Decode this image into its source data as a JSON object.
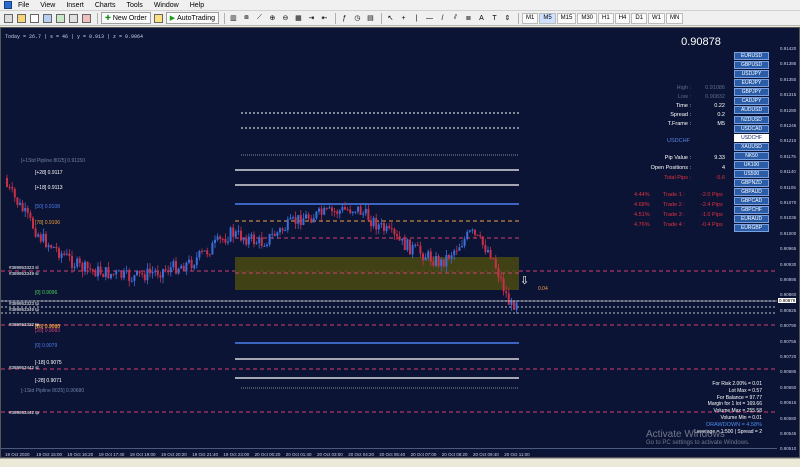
{
  "menu": [
    "File",
    "View",
    "Insert",
    "Charts",
    "Tools",
    "Window",
    "Help"
  ],
  "toolbar": {
    "new_order": "New Order",
    "autotrading": "AutoTrading",
    "timeframes": [
      "M1",
      "M5",
      "M15",
      "M30",
      "H1",
      "H4",
      "D1",
      "W1",
      "MN"
    ],
    "active_tf": "M5"
  },
  "infoline": "Today = 26.7   |   s = 46   |   y = 0.913   |   z = 0.9064",
  "panel": {
    "price": "0.90878",
    "rows": [
      {
        "k": "High :",
        "v": "0.91086",
        "dim": true
      },
      {
        "k": "Low :",
        "v": "0.90832",
        "dim": true
      },
      {
        "k": "Time :",
        "v": "0.22",
        "dim": false
      },
      {
        "k": "Spread :",
        "v": "0.2",
        "dim": false
      },
      {
        "k": "T.Frame :",
        "v": "M5",
        "dim": false
      }
    ],
    "symbol": "USDCHF",
    "pip_rows": [
      {
        "k": "Pip Value :",
        "v": "9.33",
        "color": "#ffffff"
      },
      {
        "k": "Open Positions :",
        "v": "4",
        "color": "#ffffff"
      },
      {
        "k": "Total Pips :",
        "v": "-5.6",
        "color": "#e03040"
      }
    ],
    "trades": [
      {
        "pct": "4.44%",
        "name": "Trade 1 :",
        "pips": "-2.0 Pips"
      },
      {
        "pct": "4.68%",
        "name": "Trade 2 :",
        "pips": "-2.4 Pips"
      },
      {
        "pct": "4.51%",
        "name": "Trade 3 :",
        "pips": "-1.0 Pips"
      },
      {
        "pct": "4.76%",
        "name": "Trade 4 :",
        "pips": "-0.4 Pips"
      }
    ]
  },
  "symbols": [
    "EURUSD",
    "GBPUSD",
    "USDJPY",
    "EURJPY",
    "GBPJPY",
    "CADJPY",
    "AUDUSD",
    "NZDUSD",
    "USDCAD",
    "USDCHF",
    "XAUUSD",
    "NK50",
    "UK100",
    "US500",
    "GBPNZD",
    "GBPAUD",
    "GBPCAD",
    "GBPCHF",
    "EURAUD",
    "EURGBP"
  ],
  "selected_symbol": "USDCHF",
  "yaxis": [
    "0.91420",
    "0.91385",
    "0.91350",
    "0.91315",
    "0.91280",
    "0.91245",
    "0.91210",
    "0.91175",
    "0.91140",
    "0.91105",
    "0.91070",
    "0.91035",
    "0.91000",
    "0.90965",
    "0.90930",
    "0.90895",
    "0.90860",
    "0.90825",
    "0.90790",
    "0.90755",
    "0.90720",
    "0.90685",
    "0.90650",
    "0.90615",
    "0.90580",
    "0.90545",
    "0.90510"
  ],
  "yaxis_current": "0.90878",
  "xaxis": [
    "19 Oct 2020",
    "19 Oct 15:00",
    "19 Oct 16:20",
    "19 Oct 17:40",
    "19 Oct 19:00",
    "19 Oct 20:20",
    "19 Oct 21:40",
    "19 Oct 23:00",
    "20 Oct 00:20",
    "20 Oct 01:40",
    "20 Oct 03:00",
    "20 Oct 04:20",
    "20 Oct 05:40",
    "20 Oct 07:00",
    "20 Oct 08:20",
    "20 Oct 09:40",
    "20 Oct 11:00"
  ],
  "levels": [
    {
      "label": "[+1Std Pipline 8025]  0.91150",
      "color": "#7080a8"
    },
    {
      "label": "[+28]  0.9117",
      "color": "#ffffff"
    },
    {
      "label": "[+18]  0.9113",
      "color": "#ffffff"
    },
    {
      "label": "[50]  0.9108",
      "color": "#4d7ef0"
    },
    {
      "label": "[78]  0.9106",
      "color": "#f0a040"
    },
    {
      "label": "[0]  0.9096",
      "color": "#4cd060"
    },
    {
      "label": "[18]  0.9090",
      "color": "#f0a040"
    },
    {
      "label": "[28]  0.9083",
      "color": "#d04070"
    },
    {
      "label": "[78]  0.9083",
      "color": "#f0a040"
    },
    {
      "label": "[0]  0.9079",
      "color": "#4d7ef0"
    },
    {
      "label": "[-18]  0.9075",
      "color": "#ffffff"
    },
    {
      "label": "[-28]  0.9071",
      "color": "#ffffff"
    },
    {
      "label": "[-1Std Pipline 8025]  0.90680",
      "color": "#7080a8"
    }
  ],
  "order_tags": [
    "#389953323 sl",
    "#389953349 sl",
    "#389953323 tp",
    "#389953349 tp",
    "#389953322 tp",
    "#389953442 sl",
    "#389953442 tp"
  ],
  "arrow_label": "0.04",
  "bottom_info": [
    "For Risk 2.00% = 0.01",
    "Lot Max = 0.57",
    "For Balance = 97.77",
    "Margin for 1 lot = 169.66",
    "Volume Max = 255.58",
    "Volume Min = 0.01",
    "DRAWDOWN = 4.58%",
    "Leverage = 1:500 | Spread = 2"
  ],
  "watermark": {
    "title": "Activate Windows",
    "sub": "Go to PC settings to activate Windows."
  },
  "colors": {
    "bg": "#0b1434",
    "bull": "#3a6ed8",
    "bear": "#c8304a",
    "box": "#4a4a10"
  }
}
